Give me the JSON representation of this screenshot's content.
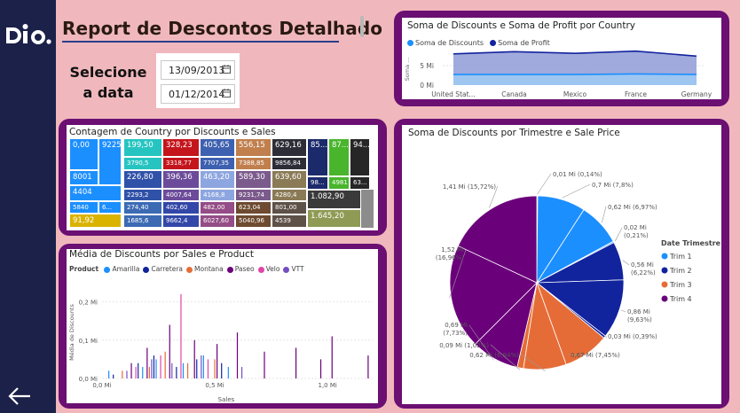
{
  "header": {
    "title": "Report de Descontos Detalhado"
  },
  "filter": {
    "label": "Selecione a data",
    "start_date": "13/09/2013",
    "end_date": "01/12/2014"
  },
  "brand": {
    "logo_text": "dio."
  },
  "colors": {
    "sidebar": "#1b2148",
    "background": "#f0b8bd",
    "panel_border": "#6b0f73",
    "series_discounts": "#1c8fff",
    "series_profit": "#12239e",
    "trim1": "#1c8fff",
    "trim2": "#12239e",
    "trim3": "#e66c37",
    "trim4": "#6b007b"
  },
  "line_panel": {
    "title": "Soma de Discounts e Soma de Profit por Country",
    "legend": [
      "Soma de Discounts",
      "Soma de Profit"
    ],
    "ylabel": "Soma ...",
    "yticks": [
      "5 Mi",
      "0 Mi"
    ],
    "chart_data": {
      "type": "area",
      "title": "Soma de Discounts e Soma de Profit por Country",
      "categories": [
        "United Stat...",
        "Canada",
        "Mexico",
        "France",
        "Germany"
      ],
      "ylim": [
        0,
        7
      ],
      "series": [
        {
          "name": "Soma de Discounts",
          "values": [
            1.9,
            1.9,
            1.9,
            2.0,
            1.9
          ]
        },
        {
          "name": "Soma de Profit",
          "values": [
            5.6,
            6.0,
            5.7,
            6.1,
            5.2
          ]
        }
      ]
    }
  },
  "treemap_panel": {
    "title": "Contagem de Country por Discounts e Sales",
    "chart_data": {
      "type": "table",
      "cells": [
        "0,00",
        "8001",
        "9225",
        "4404",
        "5840",
        "6...",
        "91,92",
        "199,50",
        "3790,5",
        "226,80",
        "2293,2",
        "274,40",
        "1685,6",
        "328,23",
        "3318,77",
        "396,36",
        "4007,64",
        "402,60",
        "9662,4",
        "405,65",
        "7707,35",
        "463,20",
        "4168,8",
        "482,00",
        "6027,60",
        "556,15",
        "7388,85",
        "589,30",
        "9231,74",
        "623,04",
        "5040,96",
        "629,16",
        "9856,84",
        "639,60",
        "4280,4",
        "801,00",
        "4539",
        "85...",
        "98...",
        "87...",
        "4981",
        "94...",
        "63...",
        "1.082,90",
        "1.645,20"
      ]
    }
  },
  "scatter_panel": {
    "title": "Média de Discounts por Sales e Product",
    "legend_title": "Product",
    "legend": [
      "Amarilla",
      "Carretera",
      "Montana",
      "Paseo",
      "Velo",
      "VTT"
    ],
    "xlabel": "Sales",
    "ylabel": "Média de Discounts",
    "yticks": [
      "0,2 Mi",
      "0,1 Mi",
      "0,0 Mi"
    ],
    "xticks": [
      "0,0 Mi",
      "0,5 Mi",
      "1,0 Mi"
    ],
    "chart_data": {
      "type": "bar",
      "title": "Média de Discounts por Sales e Product",
      "xlabel": "Sales",
      "ylabel": "Média de Discounts",
      "xlim": [
        0,
        1.2
      ],
      "ylim": [
        0,
        0.25
      ],
      "series": [
        {
          "name": "Amarilla",
          "x": [
            0.03,
            0.18,
            0.24,
            0.36,
            0.45,
            0.56
          ],
          "y": [
            0.02,
            0.03,
            0.05,
            0.04,
            0.06,
            0.03
          ]
        },
        {
          "name": "Carretera",
          "x": [
            0.05,
            0.16,
            0.23,
            0.33,
            0.42,
            0.53
          ],
          "y": [
            0.01,
            0.04,
            0.06,
            0.03,
            0.05,
            0.04
          ]
        },
        {
          "name": "Montana",
          "x": [
            0.09,
            0.21,
            0.28,
            0.38,
            0.5
          ],
          "y": [
            0.02,
            0.03,
            0.07,
            0.04,
            0.05
          ]
        },
        {
          "name": "Paseo",
          "x": [
            0.13,
            0.2,
            0.3,
            0.41,
            0.51,
            0.6,
            0.72,
            0.86,
            0.97,
            1.02,
            1.18
          ],
          "y": [
            0.04,
            0.08,
            0.14,
            0.1,
            0.09,
            0.12,
            0.07,
            0.08,
            0.05,
            0.11,
            0.06
          ]
        },
        {
          "name": "Velo",
          "x": [
            0.15,
            0.26,
            0.35,
            0.47
          ],
          "y": [
            0.03,
            0.06,
            0.22,
            0.05
          ]
        },
        {
          "name": "VTT",
          "x": [
            0.11,
            0.22,
            0.31,
            0.44,
            0.62
          ],
          "y": [
            0.02,
            0.05,
            0.04,
            0.06,
            0.03
          ]
        }
      ]
    }
  },
  "pie_panel": {
    "title": "Soma de Discounts por Trimestre e Sale Price",
    "legend_title": "Date Trimestre",
    "legend": [
      "Trim 1",
      "Trim 2",
      "Trim 3",
      "Trim 4"
    ],
    "chart_data": {
      "type": "pie",
      "title": "Soma de Discounts por Trimestre e Sale Price",
      "slices": [
        {
          "label": "0,01 Mi (0,14%)",
          "value": 0.14,
          "group": "Trim 1"
        },
        {
          "label": "0,7 Mi (7,8%)",
          "value": 7.8,
          "group": "Trim 1"
        },
        {
          "label": "0,62 Mi (6,97%)",
          "value": 6.97,
          "group": "Trim 1"
        },
        {
          "label": "0,02 Mi (0,21%)",
          "value": 0.21,
          "group": "Trim 1"
        },
        {
          "label": "0,56 Mi (6,22%)",
          "value": 6.22,
          "group": "Trim 2"
        },
        {
          "label": "0,86 Mi (9,63%)",
          "value": 9.63,
          "group": "Trim 2"
        },
        {
          "label": "0,03 Mi (0,39%)",
          "value": 0.39,
          "group": "Trim 2"
        },
        {
          "label": "0,67 Mi (7,45%)",
          "value": 7.45,
          "group": "Trim 3"
        },
        {
          "label": "0,62 Mi (6,94%)",
          "value": 6.94,
          "group": "Trim 3"
        },
        {
          "label": "0,09 Mi (1,02%)",
          "value": 1.02,
          "group": "Trim 3"
        },
        {
          "label": "0,69 Mi (7,73%)",
          "value": 7.73,
          "group": "Trim 4"
        },
        {
          "label": "1,52 Mi (16,96%)",
          "value": 16.96,
          "group": "Trim 4"
        },
        {
          "label": "1,41 Mi (15,72%)",
          "value": 15.72,
          "group": "Trim 4"
        }
      ]
    }
  }
}
